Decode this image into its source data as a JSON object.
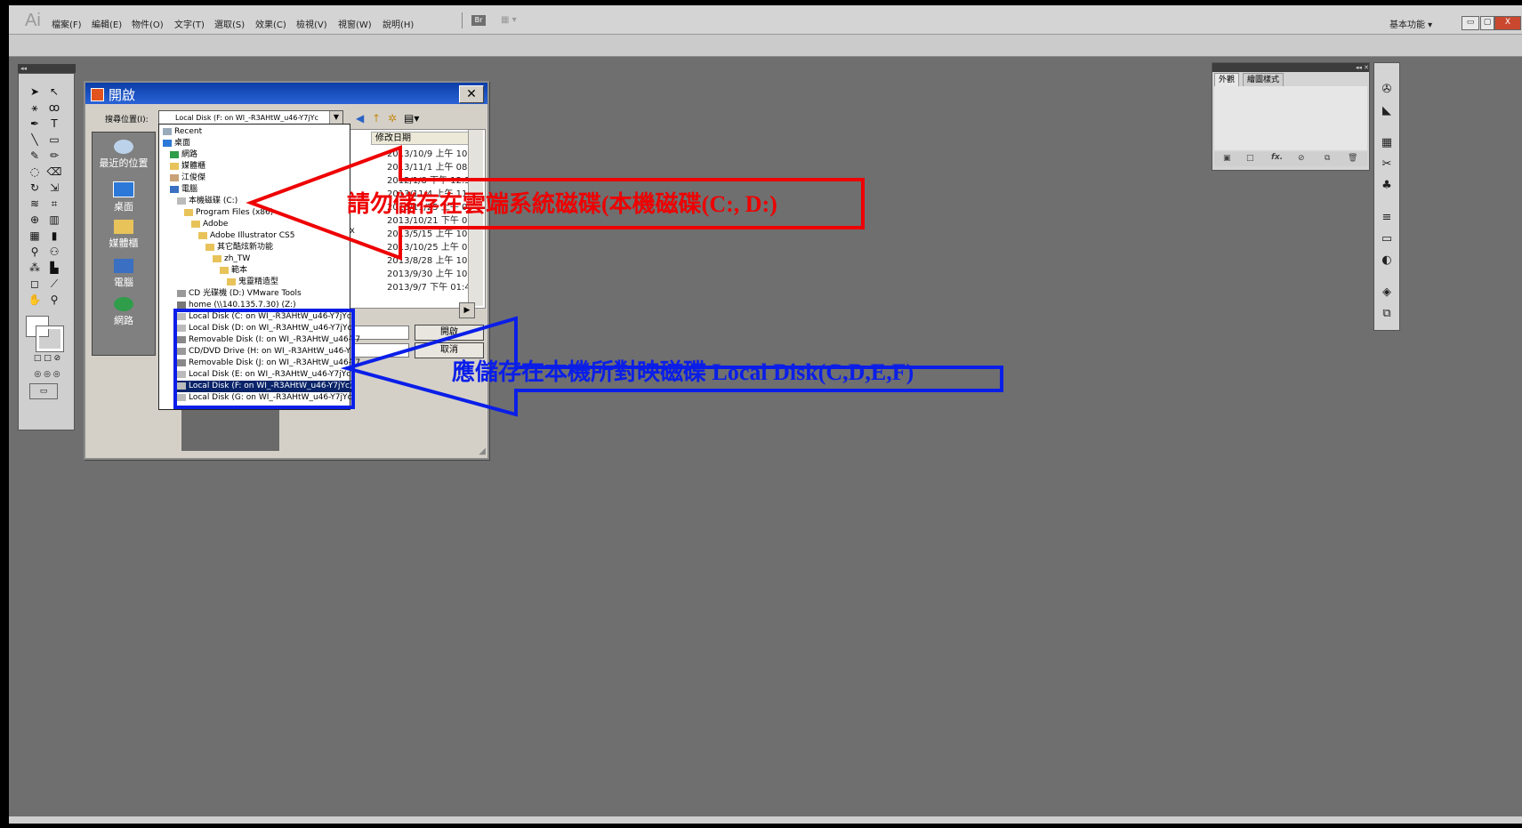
{
  "app": {
    "logo": "Ai",
    "menus": [
      "檔案(F)",
      "編輯(E)",
      "物件(O)",
      "文字(T)",
      "選取(S)",
      "效果(C)",
      "檢視(V)",
      "視窗(W)",
      "說明(H)"
    ],
    "bridge_label": "Br",
    "workspace_label": "基本功能 ▾",
    "window_buttons": [
      "▭",
      "▢",
      "X"
    ]
  },
  "dialog": {
    "title": "開啟",
    "lookin_label": "搜尋位置(I):",
    "lookin_value": "Local Disk (F: on WI_-R3AHtW_u46-Y7jYc",
    "places": [
      "最近的位置",
      "桌面",
      "媒體櫃",
      "電腦",
      "網路"
    ],
    "column_header": "修改日期",
    "dates": [
      "2013/10/9 上午 10..",
      "2013/11/1 上午 08..",
      "2012/1/8 下午 12:54",
      "2013/11/4 上午 11..",
      "2013/11/25 上午 0..",
      "2013/10/21 下午 0..",
      "2013/5/15 上午 10..",
      "2013/10/25 上午 0..",
      "2013/8/28 上午 10..",
      "2013/9/30 上午 10..",
      "2013/9/7 下午 01:49"
    ],
    "stray_char": "x",
    "open_button": "開啟",
    "cancel_button": "取消",
    "dropdown": [
      "Recent",
      "桌面",
      "網路",
      "媒體櫃",
      "江俊傑",
      "電腦",
      "本機磁碟 (C:)",
      "Program Files (x86)",
      "Adobe",
      "Adobe Illustrator CS5",
      "其它酷炫新功能",
      "zh_TW",
      "範本",
      "鬼靈精造型",
      "CD 光碟機 (D:) VMware Tools",
      "home (\\\\140.135.7.30) (Z:)",
      "Local Disk (C: on WI_-R3AHtW_u46-Y7jYc)",
      "Local Disk (D: on WI_-R3AHtW_u46-Y7jYc)",
      "Removable Disk (I: on WI_-R3AHtW_u46-Y7",
      "CD/DVD Drive (H: on WI_-R3AHtW_u46-Y7",
      "Removable Disk (J: on WI_-R3AHtW_u46-Y7",
      "Local Disk (E: on WI_-R3AHtW_u46-Y7jYc)",
      "Local Disk (F: on WI_-R3AHtW_u46-Y7jYc)",
      "Local Disk (G: on WI_-R3AHtW_u46-Y7jYc)"
    ]
  },
  "annotations": {
    "red_text": "請勿儲存在雲端系統磁碟(本機磁碟(C:, D:)",
    "blue_text": "應儲存在本機所對映磁碟 Local Disk(C,D,E,F)",
    "red_color": "#e00000",
    "blue_color": "#0a1ee8"
  },
  "panels": {
    "appearance_tabs": [
      "外觀",
      "繪圖樣式"
    ],
    "fx_label": "fx."
  },
  "icons": [
    "ai-logo-icon",
    "bridge-icon",
    "back-icon",
    "up-folder-icon",
    "new-folder-icon",
    "view-menu-icon",
    "close-icon",
    "recent-places-icon",
    "desktop-icon",
    "library-icon",
    "computer-icon",
    "network-icon",
    "drive-icon",
    "folder-icon"
  ]
}
